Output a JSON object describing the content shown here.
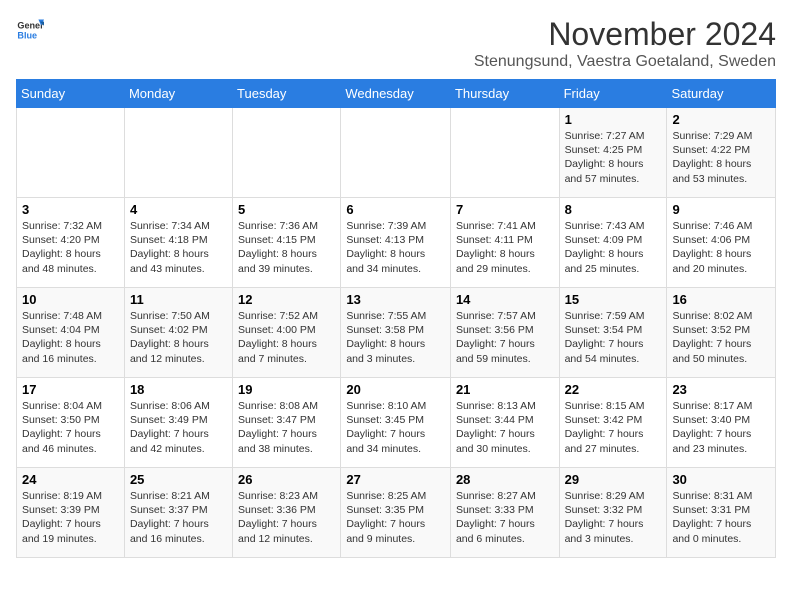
{
  "logo": {
    "text_general": "General",
    "text_blue": "Blue"
  },
  "title": "November 2024",
  "subtitle": "Stenungsund, Vaestra Goetaland, Sweden",
  "headers": [
    "Sunday",
    "Monday",
    "Tuesday",
    "Wednesday",
    "Thursday",
    "Friday",
    "Saturday"
  ],
  "weeks": [
    {
      "days": [
        {
          "num": "",
          "info": ""
        },
        {
          "num": "",
          "info": ""
        },
        {
          "num": "",
          "info": ""
        },
        {
          "num": "",
          "info": ""
        },
        {
          "num": "",
          "info": ""
        },
        {
          "num": "1",
          "info": "Sunrise: 7:27 AM\nSunset: 4:25 PM\nDaylight: 8 hours\nand 57 minutes."
        },
        {
          "num": "2",
          "info": "Sunrise: 7:29 AM\nSunset: 4:22 PM\nDaylight: 8 hours\nand 53 minutes."
        }
      ]
    },
    {
      "days": [
        {
          "num": "3",
          "info": "Sunrise: 7:32 AM\nSunset: 4:20 PM\nDaylight: 8 hours\nand 48 minutes."
        },
        {
          "num": "4",
          "info": "Sunrise: 7:34 AM\nSunset: 4:18 PM\nDaylight: 8 hours\nand 43 minutes."
        },
        {
          "num": "5",
          "info": "Sunrise: 7:36 AM\nSunset: 4:15 PM\nDaylight: 8 hours\nand 39 minutes."
        },
        {
          "num": "6",
          "info": "Sunrise: 7:39 AM\nSunset: 4:13 PM\nDaylight: 8 hours\nand 34 minutes."
        },
        {
          "num": "7",
          "info": "Sunrise: 7:41 AM\nSunset: 4:11 PM\nDaylight: 8 hours\nand 29 minutes."
        },
        {
          "num": "8",
          "info": "Sunrise: 7:43 AM\nSunset: 4:09 PM\nDaylight: 8 hours\nand 25 minutes."
        },
        {
          "num": "9",
          "info": "Sunrise: 7:46 AM\nSunset: 4:06 PM\nDaylight: 8 hours\nand 20 minutes."
        }
      ]
    },
    {
      "days": [
        {
          "num": "10",
          "info": "Sunrise: 7:48 AM\nSunset: 4:04 PM\nDaylight: 8 hours\nand 16 minutes."
        },
        {
          "num": "11",
          "info": "Sunrise: 7:50 AM\nSunset: 4:02 PM\nDaylight: 8 hours\nand 12 minutes."
        },
        {
          "num": "12",
          "info": "Sunrise: 7:52 AM\nSunset: 4:00 PM\nDaylight: 8 hours\nand 7 minutes."
        },
        {
          "num": "13",
          "info": "Sunrise: 7:55 AM\nSunset: 3:58 PM\nDaylight: 8 hours\nand 3 minutes."
        },
        {
          "num": "14",
          "info": "Sunrise: 7:57 AM\nSunset: 3:56 PM\nDaylight: 7 hours\nand 59 minutes."
        },
        {
          "num": "15",
          "info": "Sunrise: 7:59 AM\nSunset: 3:54 PM\nDaylight: 7 hours\nand 54 minutes."
        },
        {
          "num": "16",
          "info": "Sunrise: 8:02 AM\nSunset: 3:52 PM\nDaylight: 7 hours\nand 50 minutes."
        }
      ]
    },
    {
      "days": [
        {
          "num": "17",
          "info": "Sunrise: 8:04 AM\nSunset: 3:50 PM\nDaylight: 7 hours\nand 46 minutes."
        },
        {
          "num": "18",
          "info": "Sunrise: 8:06 AM\nSunset: 3:49 PM\nDaylight: 7 hours\nand 42 minutes."
        },
        {
          "num": "19",
          "info": "Sunrise: 8:08 AM\nSunset: 3:47 PM\nDaylight: 7 hours\nand 38 minutes."
        },
        {
          "num": "20",
          "info": "Sunrise: 8:10 AM\nSunset: 3:45 PM\nDaylight: 7 hours\nand 34 minutes."
        },
        {
          "num": "21",
          "info": "Sunrise: 8:13 AM\nSunset: 3:44 PM\nDaylight: 7 hours\nand 30 minutes."
        },
        {
          "num": "22",
          "info": "Sunrise: 8:15 AM\nSunset: 3:42 PM\nDaylight: 7 hours\nand 27 minutes."
        },
        {
          "num": "23",
          "info": "Sunrise: 8:17 AM\nSunset: 3:40 PM\nDaylight: 7 hours\nand 23 minutes."
        }
      ]
    },
    {
      "days": [
        {
          "num": "24",
          "info": "Sunrise: 8:19 AM\nSunset: 3:39 PM\nDaylight: 7 hours\nand 19 minutes."
        },
        {
          "num": "25",
          "info": "Sunrise: 8:21 AM\nSunset: 3:37 PM\nDaylight: 7 hours\nand 16 minutes."
        },
        {
          "num": "26",
          "info": "Sunrise: 8:23 AM\nSunset: 3:36 PM\nDaylight: 7 hours\nand 12 minutes."
        },
        {
          "num": "27",
          "info": "Sunrise: 8:25 AM\nSunset: 3:35 PM\nDaylight: 7 hours\nand 9 minutes."
        },
        {
          "num": "28",
          "info": "Sunrise: 8:27 AM\nSunset: 3:33 PM\nDaylight: 7 hours\nand 6 minutes."
        },
        {
          "num": "29",
          "info": "Sunrise: 8:29 AM\nSunset: 3:32 PM\nDaylight: 7 hours\nand 3 minutes."
        },
        {
          "num": "30",
          "info": "Sunrise: 8:31 AM\nSunset: 3:31 PM\nDaylight: 7 hours\nand 0 minutes."
        }
      ]
    }
  ]
}
